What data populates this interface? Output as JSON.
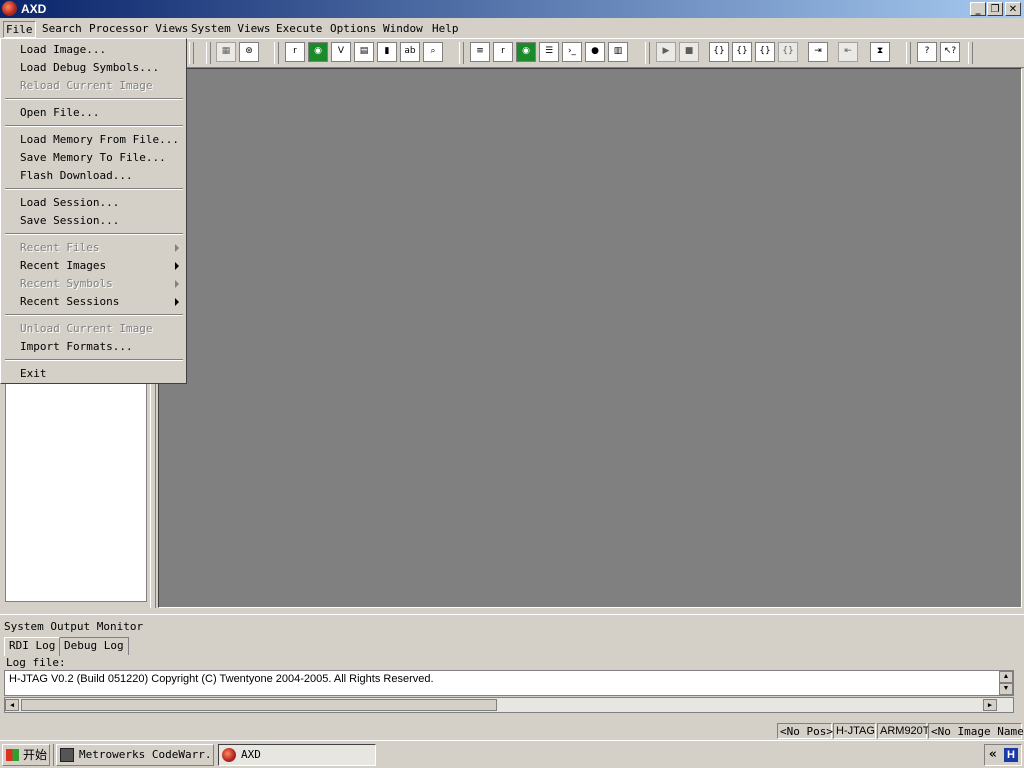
{
  "window": {
    "title": "AXD"
  },
  "menubar": {
    "items": [
      "File",
      "Search",
      "Processor Views",
      "System Views",
      "Execute",
      "Options",
      "Window",
      "Help"
    ]
  },
  "file_menu": {
    "items": [
      {
        "label": "Load Image...",
        "enabled": true
      },
      {
        "label": "Load Debug Symbols...",
        "enabled": true
      },
      {
        "label": "Reload Current Image",
        "enabled": false
      },
      {
        "label": "Open File...",
        "enabled": true
      },
      {
        "label": "Load Memory From File...",
        "enabled": true
      },
      {
        "label": "Save Memory To File...",
        "enabled": true
      },
      {
        "label": "Flash Download...",
        "enabled": true
      },
      {
        "label": "Load Session...",
        "enabled": true
      },
      {
        "label": "Save Session...",
        "enabled": true
      },
      {
        "label": "Recent Files",
        "enabled": false,
        "submenu": true
      },
      {
        "label": "Recent Images",
        "enabled": true,
        "submenu": true
      },
      {
        "label": "Recent Symbols",
        "enabled": false,
        "submenu": true
      },
      {
        "label": "Recent Sessions",
        "enabled": true,
        "submenu": true
      },
      {
        "label": "Unload Current Image",
        "enabled": false
      },
      {
        "label": "Import Formats...",
        "enabled": true
      },
      {
        "label": "Exit",
        "enabled": true
      }
    ]
  },
  "toolbar": {
    "icons": [
      "memory-icon",
      "binoculars-icon",
      "registers-icon",
      "watch-icon",
      "variables-icon",
      "low-level-symbols-icon",
      "memory-view-icon",
      "debugger-internals-icon",
      "find-icon",
      "source-icon",
      "registers-icon",
      "watch-icon",
      "disassembly-icon",
      "console-icon",
      "breakpoints-icon",
      "memory-map-icon",
      "run-icon",
      "stop-icon",
      "step-in-icon",
      "step-icon",
      "step-out-icon",
      "run-to-cursor-icon",
      "toggle-breakpoint-icon",
      "locate-pc-icon",
      "hourglass-icon",
      "help-icon",
      "context-help-icon"
    ]
  },
  "output_monitor": {
    "title": "System Output Monitor",
    "tabs": [
      "RDI Log",
      "Debug Log"
    ],
    "active_tab": "RDI Log",
    "log_file_label": "Log file:",
    "log_text": "H-JTAG V0.2 (Build 051220) Copyright (C) Twentyone 2004-2005. All Rights Reserved."
  },
  "statusbar": {
    "fields": [
      "<No Pos>",
      "H-JTAG",
      "ARM920T",
      "<No Image Name>"
    ]
  },
  "taskbar": {
    "start_label": "开始",
    "tasks": [
      {
        "label": "Metrowerks CodeWarr...",
        "active": false
      },
      {
        "label": "AXD",
        "active": true
      }
    ],
    "tray_icons": [
      "expand-tray-icon",
      "h-jtag-icon"
    ]
  }
}
